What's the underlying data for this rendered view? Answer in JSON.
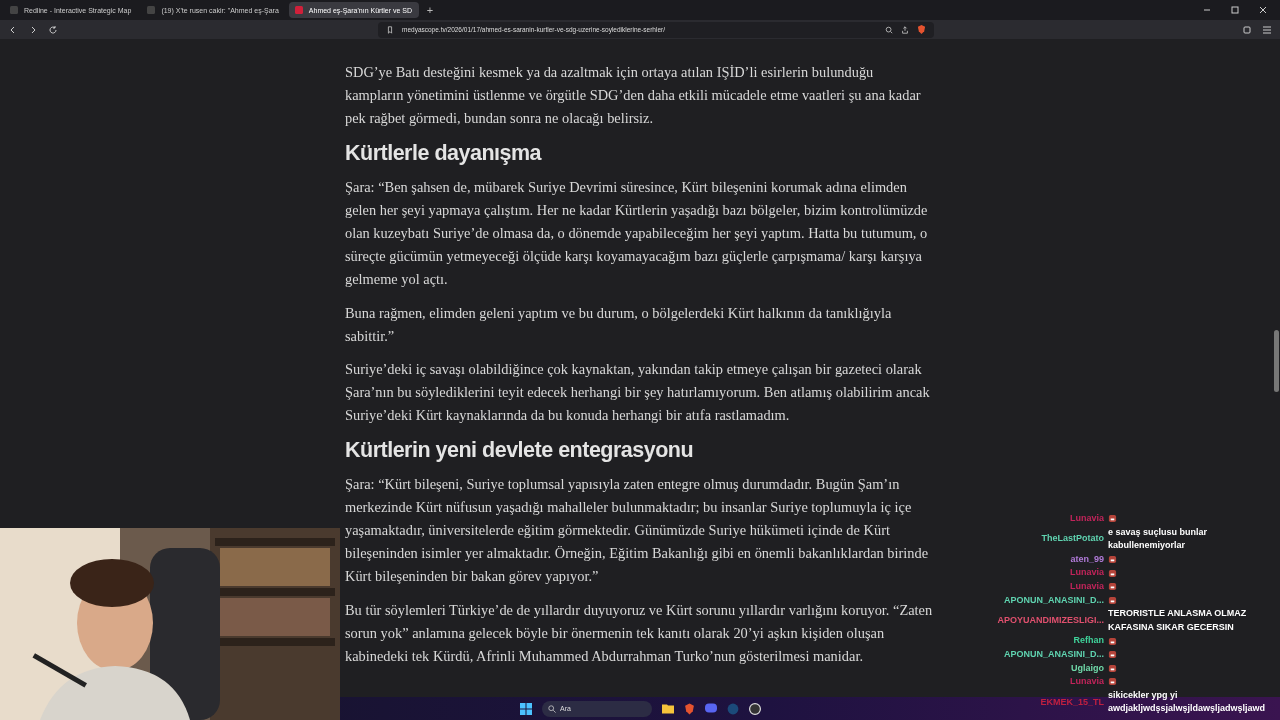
{
  "tabs": [
    {
      "label": "Redline - Interactive Strategic Map",
      "selected": false
    },
    {
      "label": "(19) X'te rusen cakir: \"Ahmed eş-Şara",
      "selected": false
    },
    {
      "label": "Ahmed eş-Şara'nın Kürtler ve SD",
      "selected": true
    }
  ],
  "new_tab": {
    "label": "+"
  },
  "address_bar": {
    "url": "medyascope.tv/2026/01/17/ahmed-es-saranin-kurtler-ve-sdg-uzerine-soylediklerine-serhler/"
  },
  "article": [
    {
      "kind": "paragraph",
      "text": "SDG’ye Batı desteğini kesmek ya da azaltmak için ortaya atılan IŞİD’li esirlerin bulunduğu kampların yönetimini üstlenme ve örgütle SDG’den daha etkili mücadele etme vaatleri şu ana kadar pek rağbet görmedi, bundan sonra ne olacağı belirsiz."
    },
    {
      "kind": "heading",
      "text": "Kürtlerle dayanışma"
    },
    {
      "kind": "paragraph",
      "text": "Şara: “Ben şahsen de, mübarek Suriye Devrimi süresince, Kürt bileşenini korumak adına elimden gelen her şeyi yapmaya çalıştım. Her ne kadar Kürtlerin yaşadığı bazı bölgeler, bizim kontrolümüzde olan kuzeybatı Suriye’de olmasa da, o dönemde yapabileceğim her şeyi yaptım. Hatta bu tutumum, o süreçte gücümün yetmeyeceği ölçüde karşı koyamayacağım bazı güçlerle çarpışmama/ karşı karşıya gelmeme yol açtı."
    },
    {
      "kind": "paragraph",
      "text": "Buna rağmen, elimden geleni yaptım ve bu durum, o bölgelerdeki Kürt halkının da tanıklığıyla sabittir.”"
    },
    {
      "kind": "paragraph",
      "text": "Suriye’deki iç savaşı olabildiğince çok kaynaktan, yakından takip etmeye çalışan bir gazeteci olarak Şara’nın bu söylediklerini teyit edecek herhangi bir şey hatırlamıyorum. Ben atlamış olabilirim ancak Suriye’deki Kürt kaynaklarında da bu konuda herhangi bir atıfa rastlamadım."
    },
    {
      "kind": "heading",
      "text": "Kürtlerin yeni devlete entegrasyonu"
    },
    {
      "kind": "paragraph",
      "text": "Şara: “Kürt bileşeni, Suriye toplumsal yapısıyla zaten entegre olmuş durumdadır. Bugün Şam’ın merkezinde Kürt nüfusun yaşadığı mahalleler bulunmaktadır; bu insanlar Suriye toplumuyla iç içe yaşamaktadır, üniversitelerde eğitim görmektedir. Günümüzde Suriye hükümeti içinde de Kürt bileşeninden isimler yer almaktadır. Örneğin, Eğitim Bakanlığı gibi en önemli bakanlıklardan birinde Kürt bileşeninden bir bakan görev yapıyor.”"
    },
    {
      "kind": "paragraph",
      "text": "Bu tür söylemleri Türkiye’de de yıllardır duyuyoruz ve Kürt sorunu yıllardır varlığını koruyor. “Zaten sorun yok” anlamına gelecek böyle bir önermenin tek kanıtı olarak 20’yi aşkın kişiden oluşan kabinedeki tek Kürdü, Afrinli Muhammed Abdurrahman Turko’nun gösterilmesi manidar."
    }
  ],
  "chat": [
    {
      "user": "Lunavia",
      "color": "#c0245a",
      "kind": "emote"
    },
    {
      "user": "TheLastPotato",
      "color": "#5fd3b0",
      "kind": "text",
      "text": "e savaş suçlusu bunlar kabullenemiyorlar"
    },
    {
      "user": "aten_99",
      "color": "#b07ad8",
      "kind": "emote"
    },
    {
      "user": "Lunavia",
      "color": "#c0245a",
      "kind": "emote"
    },
    {
      "user": "Lunavia",
      "color": "#c0245a",
      "kind": "emote"
    },
    {
      "user": "APONUN_ANASINI_D...",
      "color": "#5fd3b0",
      "kind": "emote"
    },
    {
      "user": "APOYUANDIMIZESLIGI...",
      "color": "#e0506e",
      "kind": "text",
      "text": "TERORISTLE ANLASMA OLMAZ KAFASINA SIKAR GECERSIN"
    },
    {
      "user": "Refhan",
      "color": "#3fd29a",
      "kind": "emote"
    },
    {
      "user": "APONUN_ANASINI_D...",
      "color": "#5fd3b0",
      "kind": "emote"
    },
    {
      "user": "Uglaigo",
      "color": "#6fd8a8",
      "kind": "emote"
    },
    {
      "user": "Lunavia",
      "color": "#c0245a",
      "kind": "emote"
    },
    {
      "user": "EKMEK_15_TL",
      "color": "#c02040",
      "kind": "text",
      "text": "sikicekler ypg yi awdjakljwdşsjalwşjldawşljadwşljawd"
    }
  ],
  "taskbar": {
    "search": {
      "placeholder": "Ara"
    }
  }
}
